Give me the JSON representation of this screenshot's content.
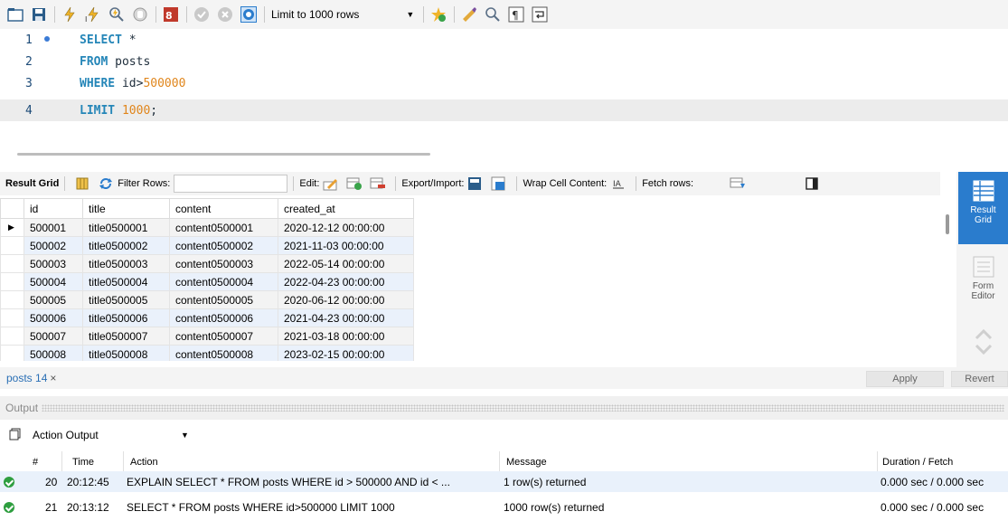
{
  "toolbar": {
    "limit_label": "Limit to 1000 rows",
    "icons": [
      "folder-icon",
      "save-icon",
      "execute-icon",
      "execute-current-icon",
      "explain-icon",
      "stop-icon",
      "toggle-error-icon",
      "commit-icon",
      "rollback-icon",
      "autocommit-icon",
      "beautify-icon",
      "find-icon",
      "invisible-chars-icon",
      "wrap-icon"
    ]
  },
  "editor": {
    "lines": [
      {
        "num": "1",
        "kw": "SELECT",
        "rest": " *",
        "numval": ""
      },
      {
        "num": "2",
        "kw": "FROM",
        "rest": " posts",
        "numval": ""
      },
      {
        "num": "3",
        "kw": "WHERE",
        "rest": " id>",
        "numval": "500000"
      },
      {
        "num": "4",
        "kw": "LIMIT",
        "rest": " ",
        "numval": "1000",
        "tail": ";"
      }
    ]
  },
  "result_toolbar": {
    "result_grid": "Result Grid",
    "filter_rows": "Filter Rows:",
    "edit": "Edit:",
    "export_import": "Export/Import:",
    "wrap_cell": "Wrap Cell Content:",
    "fetch_rows": "Fetch rows:"
  },
  "grid": {
    "columns": [
      "id",
      "title",
      "content",
      "created_at"
    ],
    "rows": [
      [
        "500001",
        "title0500001",
        "content0500001",
        "2020-12-12 00:00:00"
      ],
      [
        "500002",
        "title0500002",
        "content0500002",
        "2021-11-03 00:00:00"
      ],
      [
        "500003",
        "title0500003",
        "content0500003",
        "2022-05-14 00:00:00"
      ],
      [
        "500004",
        "title0500004",
        "content0500004",
        "2022-04-23 00:00:00"
      ],
      [
        "500005",
        "title0500005",
        "content0500005",
        "2020-06-12 00:00:00"
      ],
      [
        "500006",
        "title0500006",
        "content0500006",
        "2021-04-23 00:00:00"
      ],
      [
        "500007",
        "title0500007",
        "content0500007",
        "2021-03-18 00:00:00"
      ],
      [
        "500008",
        "title0500008",
        "content0500008",
        "2023-02-15 00:00:00"
      ]
    ]
  },
  "side_panel": {
    "result_grid": [
      "Result",
      "Grid"
    ],
    "form_editor": [
      "Form",
      "Editor"
    ]
  },
  "tabs": {
    "active_tab": "posts 14",
    "close": "×",
    "apply": "Apply",
    "revert": "Revert"
  },
  "output": {
    "header": "Output",
    "selector": "Action Output",
    "columns": {
      "num": "#",
      "time": "Time",
      "action": "Action",
      "message": "Message",
      "duration": "Duration / Fetch"
    },
    "rows": [
      {
        "num": "20",
        "time": "20:12:45",
        "action": "EXPLAIN SELECT * FROM posts WHERE id > 500000 AND id < ...",
        "message": "1 row(s) returned",
        "duration": "0.000 sec / 0.000 sec"
      },
      {
        "num": "21",
        "time": "20:13:12",
        "action": "SELECT * FROM posts WHERE id>500000 LIMIT 1000",
        "message": "1000 row(s) returned",
        "duration": "0.000 sec / 0.000 sec"
      }
    ]
  },
  "colors": {
    "accent": "#2a7ccd",
    "keyword": "#2586b8",
    "number": "#e0851b",
    "success": "#2e9e3f"
  }
}
